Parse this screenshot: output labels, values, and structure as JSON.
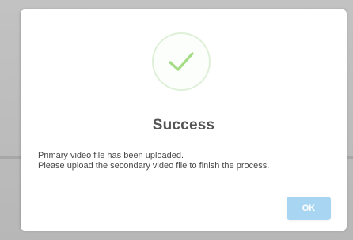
{
  "dialog": {
    "icon": "checkmark-success-icon",
    "title": "Success",
    "message_lines": [
      "Primary video file has been uploaded.",
      "Please upload the secondary video file to finish the process."
    ],
    "ok_label": "OK"
  },
  "colors": {
    "check": "#a5dc86",
    "check_ring": "#dff0d8",
    "button": "#a8d6f2",
    "title": "#545454"
  }
}
